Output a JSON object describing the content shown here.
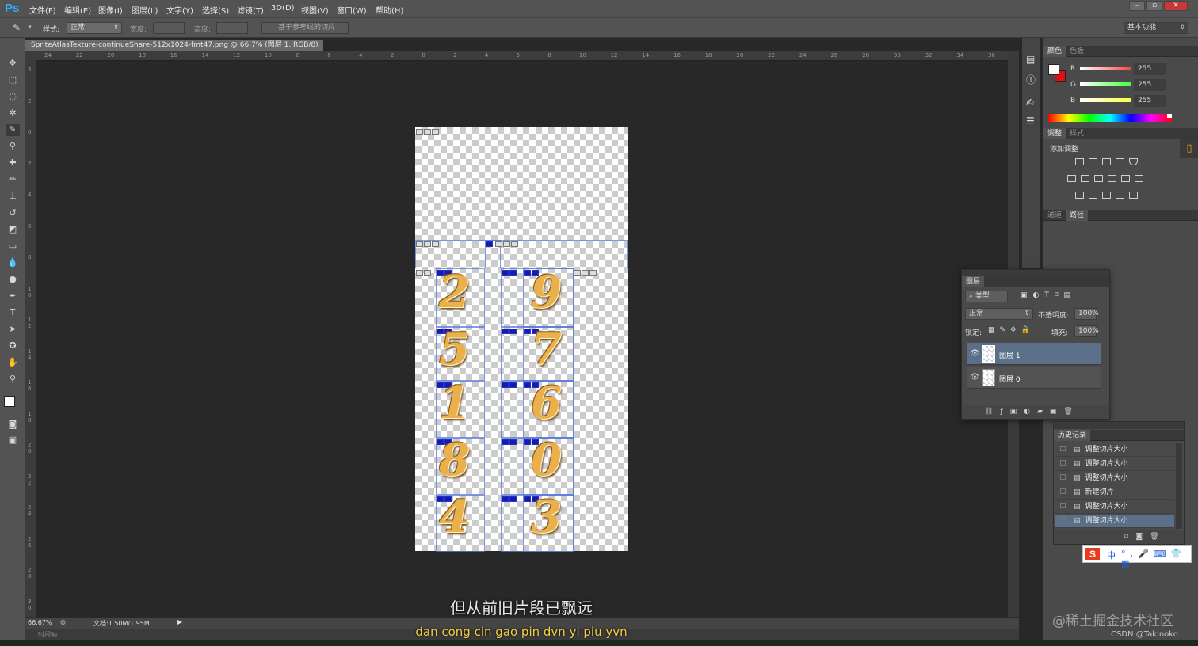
{
  "app": {
    "logo": "Ps"
  },
  "menu": [
    "文件(F)",
    "编辑(E)",
    "图像(I)",
    "图层(L)",
    "文字(Y)",
    "选择(S)",
    "滤镜(T)",
    "3D(D)",
    "视图(V)",
    "窗口(W)",
    "帮助(H)"
  ],
  "options": {
    "style_label": "样式:",
    "style_value": "正常",
    "width_label": "宽度:",
    "height_label": "高度:",
    "slice_button": "基于参考线的切片",
    "workspace": "基本功能"
  },
  "document": {
    "tab_title": "SpriteAtlasTexture-continueShare-512x1024-fmt47.png @ 66.7% (图层 1, RGB/8) *",
    "close": "×"
  },
  "ruler_h": [
    "24",
    "22",
    "20",
    "18",
    "16",
    "14",
    "12",
    "10",
    "8",
    "6",
    "4",
    "2",
    "0",
    "2",
    "4",
    "6",
    "8",
    "10",
    "12",
    "14",
    "16",
    "18",
    "20",
    "22",
    "24",
    "26",
    "28",
    "30",
    "32",
    "34",
    "36"
  ],
  "ruler_v": [
    "4",
    "2",
    "0",
    "2",
    "4",
    "6",
    "8",
    "1 0",
    "1 2",
    "1 4",
    "1 6",
    "1 8",
    "2 0",
    "2 2",
    "2 4",
    "2 6",
    "2 8",
    "3 0"
  ],
  "digits": [
    "2",
    "9",
    "5",
    "7",
    "1",
    "6",
    "8",
    "0",
    "4",
    "3"
  ],
  "status": {
    "zoom": "66.67%",
    "doc": "文档:1.50M/1.95M",
    "timeline": "时间轴"
  },
  "color_panel": {
    "tabs": [
      "颜色",
      "色板"
    ],
    "channels": [
      {
        "label": "R",
        "value": "255",
        "color": "#ff4444"
      },
      {
        "label": "G",
        "value": "255",
        "color": "#44ff44"
      },
      {
        "label": "B",
        "value": "255",
        "color": "#ffff44"
      }
    ]
  },
  "adjust_panel": {
    "tabs": [
      "调整",
      "样式"
    ],
    "title": "添加调整"
  },
  "channel_panel": {
    "tabs": [
      "通道",
      "路径"
    ]
  },
  "layers_panel": {
    "title": "图层",
    "filter": "类型",
    "blend": "正常",
    "opacity_label": "不透明度:",
    "opacity": "100%",
    "lock_label": "锁定:",
    "fill_label": "填充:",
    "fill": "100%",
    "layers": [
      "图层 1",
      "图层 0"
    ]
  },
  "history_panel": {
    "title": "历史记录",
    "items": [
      "调整切片大小",
      "调整切片大小",
      "调整切片大小",
      "新建切片",
      "调整切片大小",
      "调整切片大小"
    ]
  },
  "ime": {
    "lang": "中"
  },
  "subtitle": {
    "line1": "但从前旧片段已飘远",
    "line2": "dan cong cin gao pin dvn yi piu yvn"
  },
  "watermark": {
    "site": "@稀土掘金技术社区",
    "author": "CSDN @Takinoko"
  }
}
